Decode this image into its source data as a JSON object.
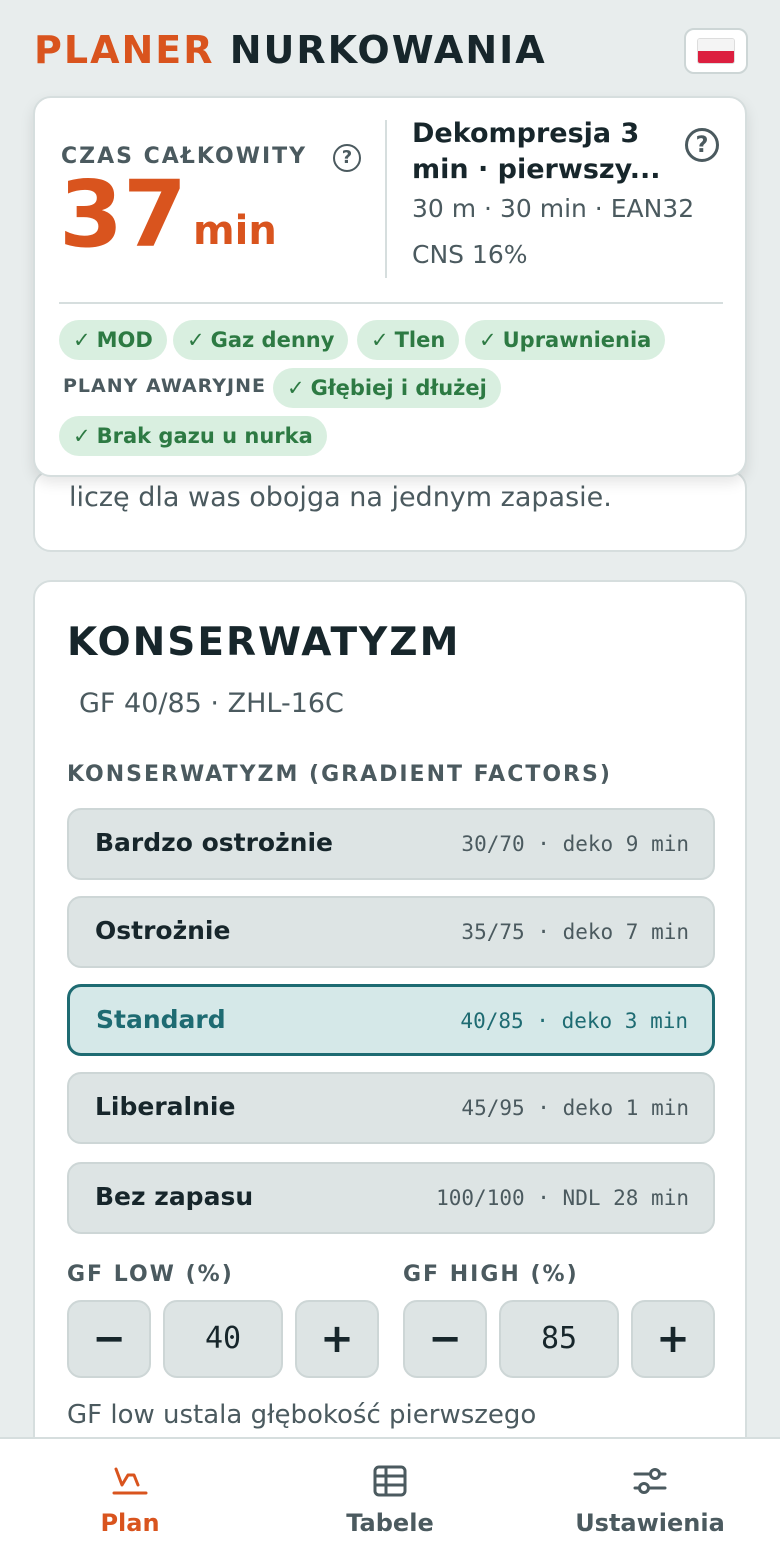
{
  "header": {
    "title_part1": "PLANER",
    "title_part2": "NURKOWANIA",
    "language": "pl"
  },
  "summary": {
    "total_label": "CZAS CAŁKOWITY",
    "total_value": "37",
    "total_unit": "min",
    "help_glyph": "?",
    "deco_line1": "Dekompresja 3",
    "deco_line2": "min · pierwszy...",
    "params": "30 m · 30 min · EAN32",
    "cns": "CNS 16%",
    "checks": [
      {
        "mark": "✓",
        "label": "MOD"
      },
      {
        "mark": "✓",
        "label": "Gaz denny"
      },
      {
        "mark": "✓",
        "label": "Tlen"
      },
      {
        "mark": "✓",
        "label": "Uprawnienia"
      }
    ],
    "plans_label": "PLANY AWARYJNE",
    "plans": [
      {
        "mark": "✓",
        "label": "Głębiej i dłużej"
      },
      {
        "mark": "✓",
        "label": "Brak gazu u nurka"
      }
    ]
  },
  "peek": {
    "text": "liczę dla was obojga na jednym zapasie."
  },
  "conservatism": {
    "title": "KONSERWATYZM",
    "subtitle": "GF 40/85 · ZHL-16C",
    "section_label": "KONSERWATYZM (GRADIENT FACTORS)",
    "options": [
      {
        "name": "Bardzo ostrożnie",
        "meta": "30/70 · deko 9 min"
      },
      {
        "name": "Ostrożnie",
        "meta": "35/75 · deko 7 min"
      },
      {
        "name": "Standard",
        "meta": "40/85 · deko 3 min"
      },
      {
        "name": "Liberalnie",
        "meta": "45/95 · deko 1 min"
      },
      {
        "name": "Bez zapasu",
        "meta": "100/100 · NDL 28 min"
      }
    ],
    "selected": "Standard",
    "gf_low_label": "GF LOW (%)",
    "gf_low_value": "40",
    "gf_high_label": "GF HIGH (%)",
    "gf_high_value": "85",
    "minus": "−",
    "plus": "+",
    "help_text": "GF low ustala głębokość pierwszego"
  },
  "nav": {
    "items": [
      {
        "label": "Plan",
        "icon": "dive-plan-icon"
      },
      {
        "label": "Tabele",
        "icon": "table-icon"
      },
      {
        "label": "Ustawienia",
        "icon": "sliders-icon"
      }
    ],
    "active": "Plan"
  },
  "colors": {
    "accent": "#d9541e",
    "teal": "#1e6b72",
    "success": "#2d7a43"
  }
}
